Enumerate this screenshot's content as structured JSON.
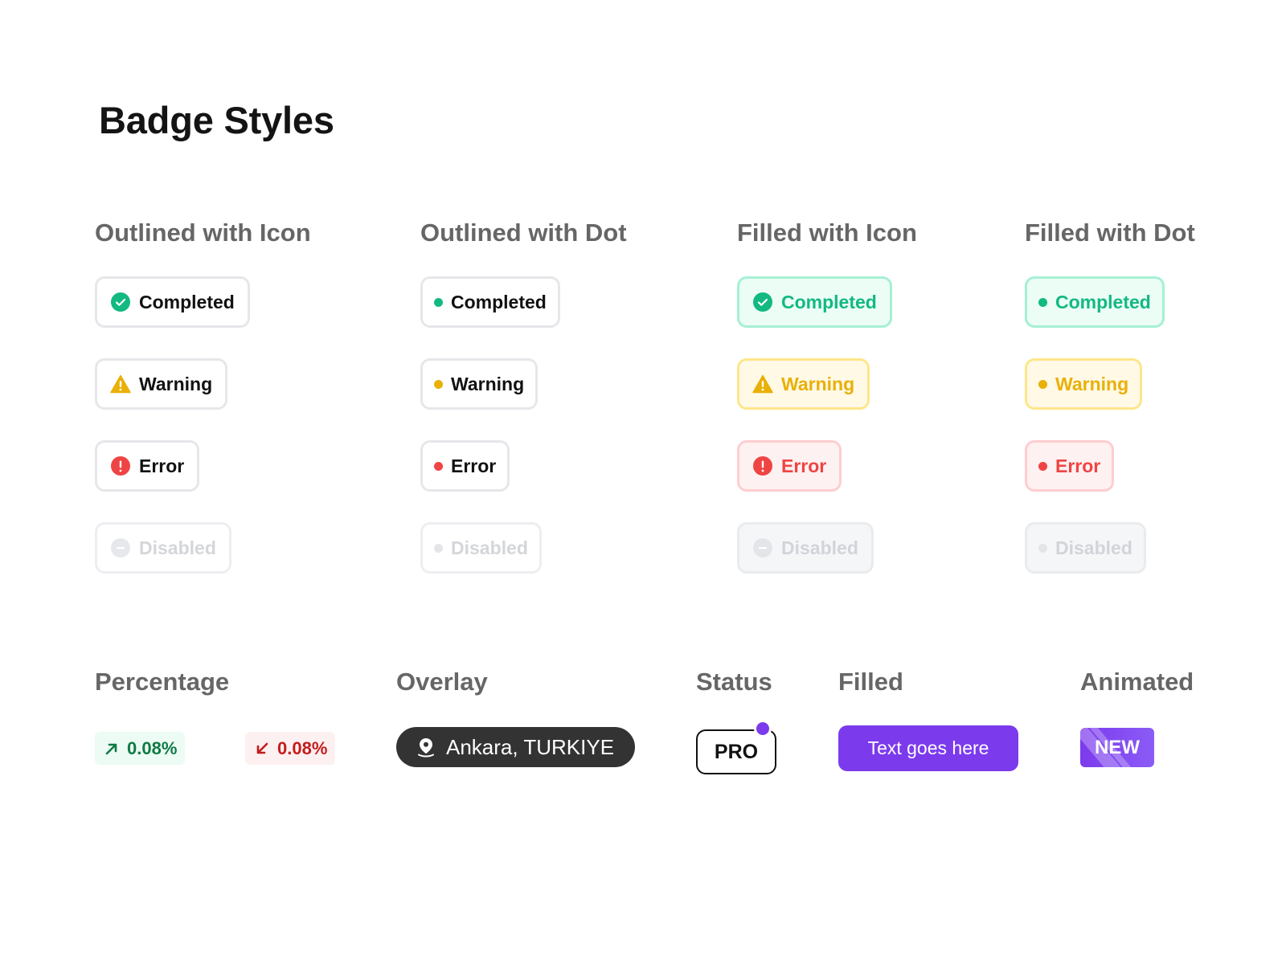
{
  "title": "Badge Styles",
  "colors": {
    "success": "#12b981",
    "warning": "#e9b008",
    "error": "#ef4444",
    "disabled": "#d4d6da",
    "accent": "#7c3aed",
    "overlay": "#333333"
  },
  "columns": {
    "outlined_icon": {
      "heading": "Outlined with Icon",
      "badges": [
        {
          "label": "Completed",
          "icon": "check-circle-icon"
        },
        {
          "label": "Warning",
          "icon": "warning-triangle-icon"
        },
        {
          "label": "Error",
          "icon": "error-circle-icon"
        },
        {
          "label": "Disabled",
          "icon": "minus-circle-icon"
        }
      ]
    },
    "outlined_dot": {
      "heading": "Outlined with Dot",
      "badges": [
        {
          "label": "Completed"
        },
        {
          "label": "Warning"
        },
        {
          "label": "Error"
        },
        {
          "label": "Disabled"
        }
      ]
    },
    "filled_icon": {
      "heading": "Filled with Icon",
      "badges": [
        {
          "label": "Completed",
          "icon": "check-circle-icon"
        },
        {
          "label": "Warning",
          "icon": "warning-triangle-icon"
        },
        {
          "label": "Error",
          "icon": "error-circle-icon"
        },
        {
          "label": "Disabled",
          "icon": "minus-circle-icon"
        }
      ]
    },
    "filled_dot": {
      "heading": "Filled with Dot",
      "badges": [
        {
          "label": "Completed"
        },
        {
          "label": "Warning"
        },
        {
          "label": "Error"
        },
        {
          "label": "Disabled"
        }
      ]
    }
  },
  "percentage": {
    "heading": "Percentage",
    "up": {
      "value": "0.08%",
      "icon": "arrow-up-right-icon"
    },
    "down": {
      "value": "0.08%",
      "icon": "arrow-down-left-icon"
    }
  },
  "overlay": {
    "heading": "Overlay",
    "label": "Ankara, TURKIYE",
    "icon": "location-pin-icon"
  },
  "status": {
    "heading": "Status",
    "label": "PRO"
  },
  "filled": {
    "heading": "Filled",
    "label": "Text goes here"
  },
  "animated": {
    "heading": "Animated",
    "label": "NEW"
  }
}
